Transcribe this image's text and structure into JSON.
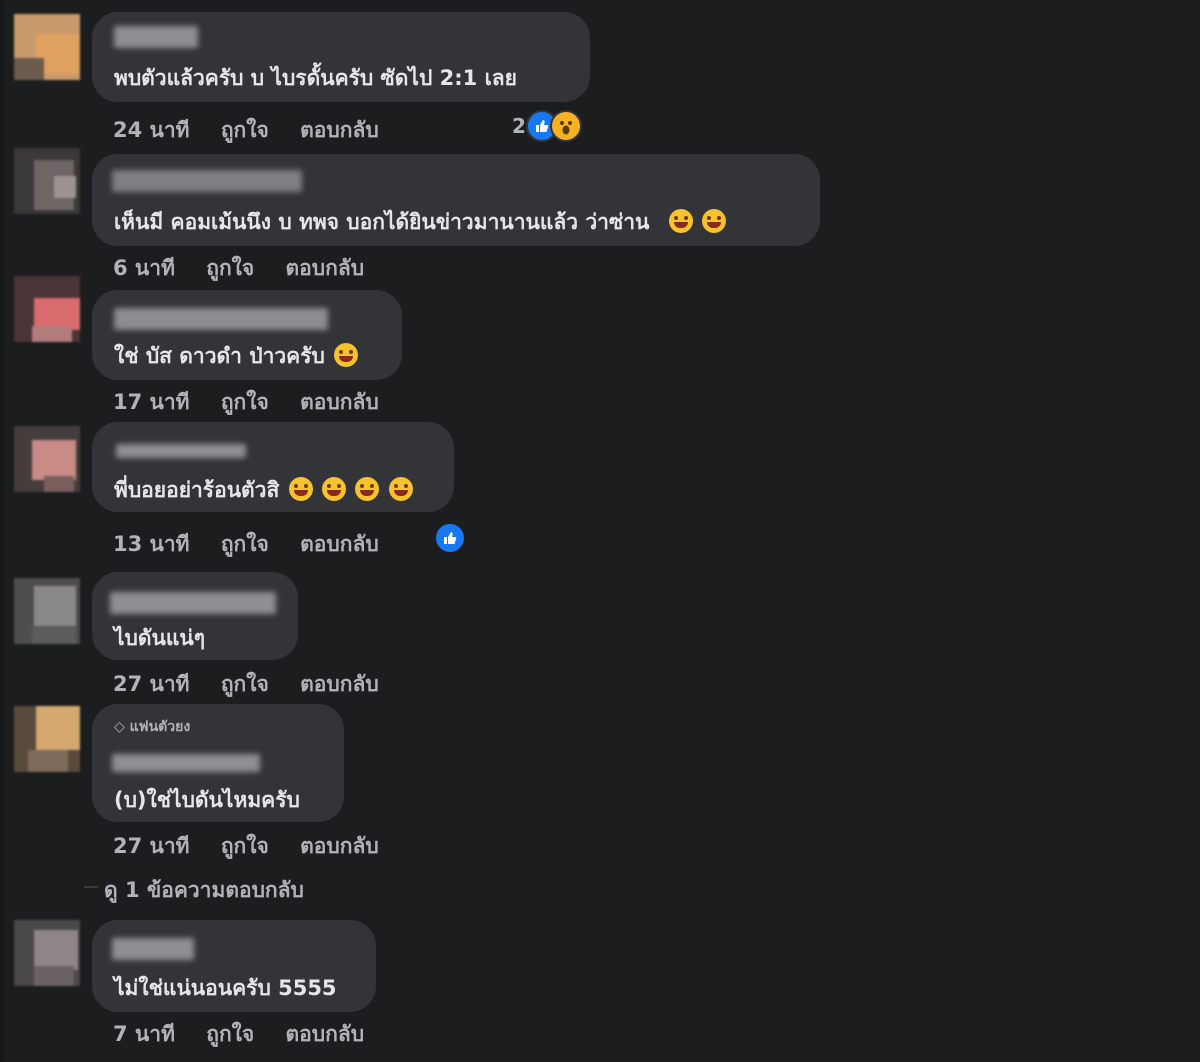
{
  "comments": [
    {
      "text": "พบตัวแล้วครับ บ ไบรดั้นครับ ซัดไป 2:1 เลย",
      "time": "24 นาที",
      "like": "ถูกใจ",
      "reply": "ตอบกลับ",
      "reaction_count": "2",
      "reactions": [
        "like-icon",
        "wow-icon"
      ]
    },
    {
      "text": "เห็นมี คอมเม้นนึง บ ทพจ บอกได้ยินข่าวมานานแล้ว ว่าซ่าน",
      "time": "6 นาที",
      "like": "ถูกใจ",
      "reply": "ตอบกลับ",
      "emojis": [
        "grin-emoji",
        "grin-emoji"
      ]
    },
    {
      "text": "ใช่ บัส ดาวดำ ป่าวครับ",
      "time": "17 นาที",
      "like": "ถูกใจ",
      "reply": "ตอบกลับ",
      "emojis": [
        "laugh-emoji"
      ]
    },
    {
      "text": "พี่บอยอย่าร้อนตัวสิ",
      "time": "13 นาที",
      "like": "ถูกใจ",
      "reply": "ตอบกลับ",
      "emojis": [
        "rofl-emoji",
        "rofl-emoji",
        "rofl-emoji",
        "rofl-emoji"
      ],
      "reactions": [
        "like-icon"
      ]
    },
    {
      "text": "ไบดันแน่ๆ",
      "time": "27 นาที",
      "like": "ถูกใจ",
      "reply": "ตอบกลับ"
    },
    {
      "badge": "แฟนตัวยง",
      "text": "(บ)ใช่ไบดันไหมครับ",
      "time": "27 นาที",
      "like": "ถูกใจ",
      "reply": "ตอบกลับ",
      "view_replies": "ดู 1 ข้อความตอบกลับ"
    },
    {
      "text": "ไม่ใช่แน่นอนครับ 5555",
      "time": "7 นาที",
      "like": "ถูกใจ",
      "reply": "ตอบกลับ"
    }
  ],
  "colors": {
    "background": "#1c1d1f",
    "bubble": "#333437",
    "like_blue": "#1877f2",
    "wow_yellow": "#f7b125"
  }
}
